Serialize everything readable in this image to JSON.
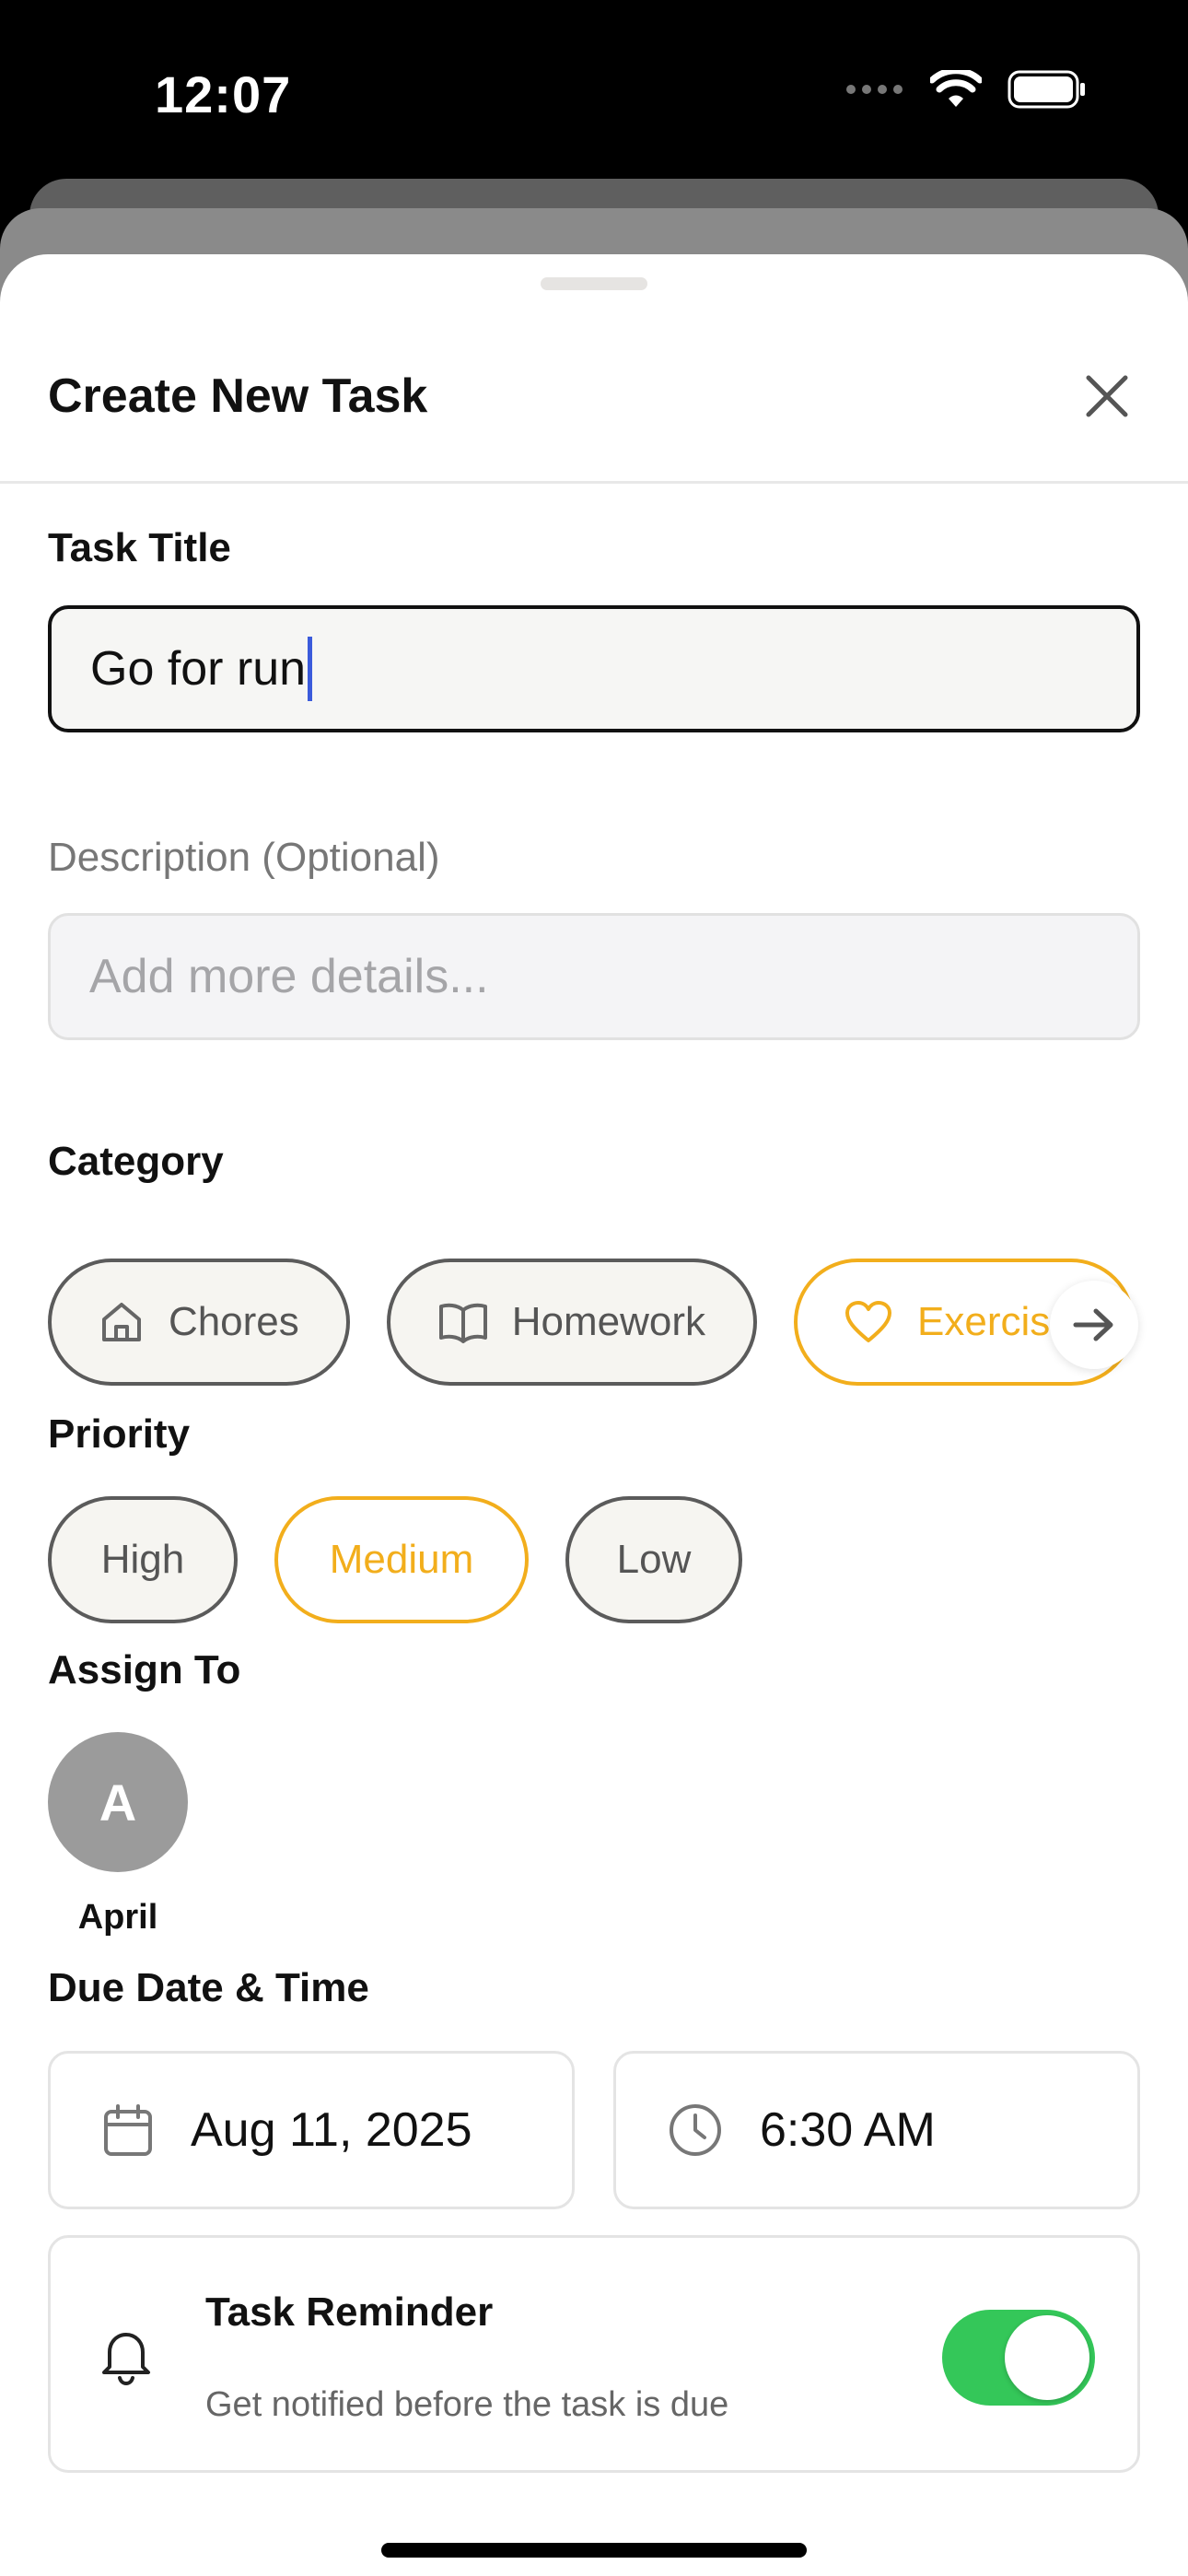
{
  "status_bar": {
    "time": "12:07"
  },
  "header": {
    "title": "Create New Task"
  },
  "task_title": {
    "label": "Task Title",
    "value": "Go for run"
  },
  "description": {
    "label": "Description (Optional)",
    "placeholder": "Add more details..."
  },
  "category": {
    "label": "Category",
    "items": [
      {
        "label": "Chores",
        "icon": "home-icon",
        "selected": false
      },
      {
        "label": "Homework",
        "icon": "book-icon",
        "selected": false
      },
      {
        "label": "Exercis",
        "icon": "heart-icon",
        "selected": true
      }
    ]
  },
  "priority": {
    "label": "Priority",
    "items": [
      {
        "label": "High",
        "selected": false
      },
      {
        "label": "Medium",
        "selected": true
      },
      {
        "label": "Low",
        "selected": false
      }
    ]
  },
  "assign": {
    "label": "Assign To",
    "initial": "A",
    "name": "April"
  },
  "due": {
    "label": "Due Date & Time",
    "date": "Aug 11, 2025",
    "time": "6:30 AM"
  },
  "reminder": {
    "title": "Task Reminder",
    "subtitle": "Get notified before the task is due",
    "enabled": true
  },
  "colors": {
    "accent": "#f2ae1c",
    "toggle_on": "#34c759",
    "caret": "#3b5bdb"
  }
}
